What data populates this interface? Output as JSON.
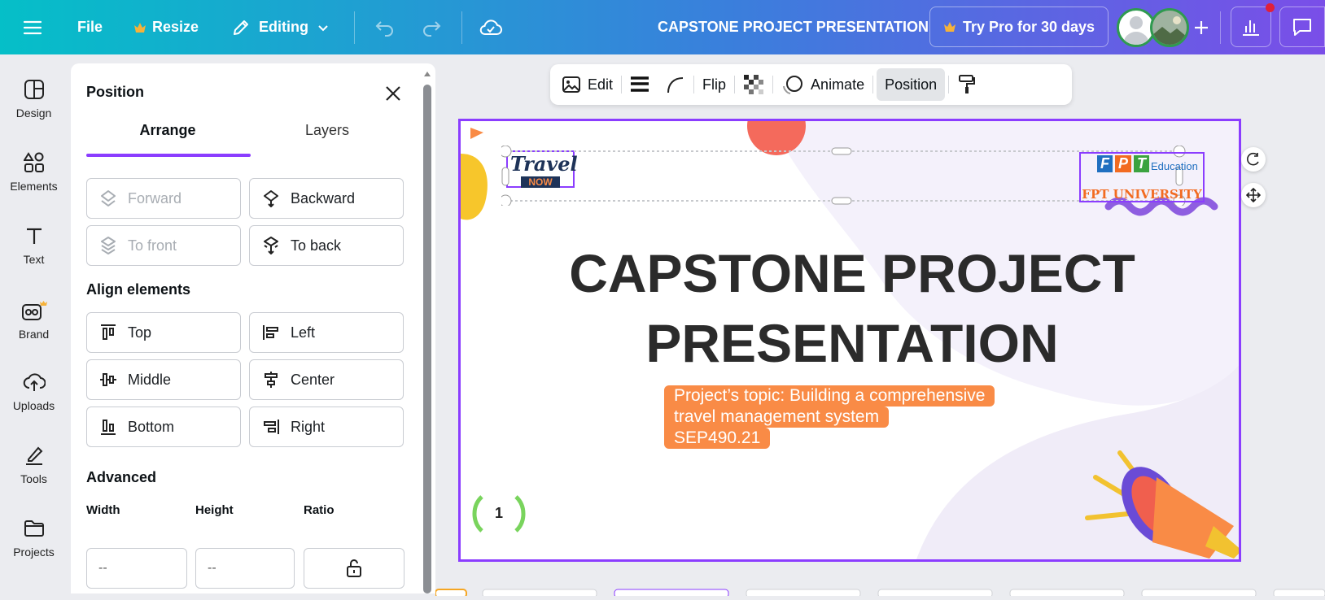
{
  "topbar": {
    "file": "File",
    "resize": "Resize",
    "mode": "Editing",
    "doc_title": "CAPSTONE PROJECT PRESENTATION",
    "try_pro": "Try Pro for 30 days",
    "colors": {
      "crown": "#f5b23a",
      "gradient_start": "#05bfc8",
      "gradient_end": "#7a4ee8",
      "notification": "#e0203a"
    }
  },
  "rail": {
    "items": [
      {
        "label": "Design",
        "icon": "design-icon"
      },
      {
        "label": "Elements",
        "icon": "elements-icon"
      },
      {
        "label": "Text",
        "icon": "text-icon"
      },
      {
        "label": "Brand",
        "icon": "brand-icon"
      },
      {
        "label": "Uploads",
        "icon": "uploads-icon"
      },
      {
        "label": "Tools",
        "icon": "tools-icon"
      },
      {
        "label": "Projects",
        "icon": "projects-icon"
      }
    ]
  },
  "panel": {
    "title": "Position",
    "tabs": [
      "Arrange",
      "Layers"
    ],
    "arrange": {
      "forward": "Forward",
      "backward": "Backward",
      "to_front": "To front",
      "to_back": "To back"
    },
    "align_heading": "Align elements",
    "align": {
      "top": "Top",
      "left": "Left",
      "middle": "Middle",
      "center": "Center",
      "bottom": "Bottom",
      "right": "Right"
    },
    "advanced_heading": "Advanced",
    "width_label": "Width",
    "height_label": "Height",
    "ratio_label": "Ratio",
    "width_value": "--",
    "height_value": "--"
  },
  "context_toolbar": {
    "edit": "Edit",
    "flip": "Flip",
    "animate": "Animate",
    "position": "Position"
  },
  "slide": {
    "logo_left_line1": "Travel",
    "logo_left_line2": "NOW",
    "fpt_letters": [
      "F",
      "P",
      "T"
    ],
    "fpt_education": "Education",
    "fpt_university": "FPT UNIVERSITY",
    "title_line1": "CAPSTONE PROJECT",
    "title_line2": "PRESENTATION",
    "topic_line1": "Project’s topic: Building a comprehensive",
    "topic_line2": "travel management system",
    "topic_line3": "SEP490.21",
    "page_number": "1",
    "accent_color": "#f98b46",
    "selection_color": "#8b3dff"
  }
}
